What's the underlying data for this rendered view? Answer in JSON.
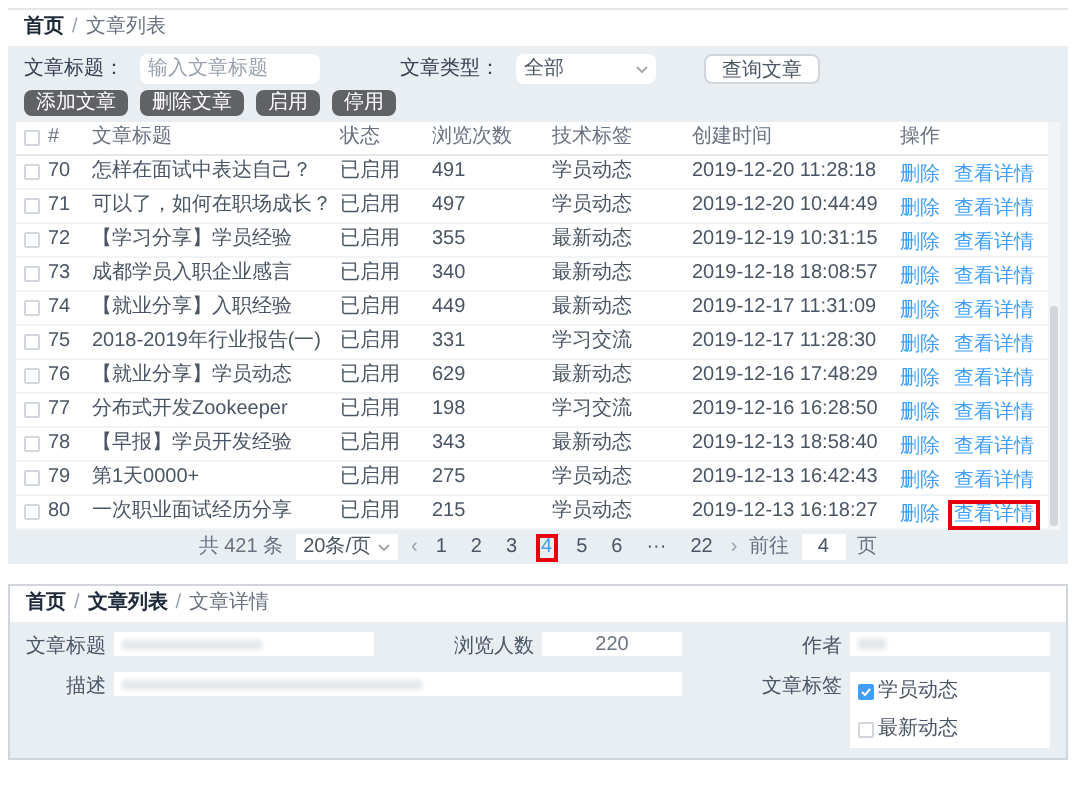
{
  "list_page": {
    "breadcrumb": [
      "首页",
      "文章列表"
    ],
    "breadcrumb_separator": "/",
    "filters": {
      "title_label": "文章标题：",
      "title_placeholder": "输入文章标题",
      "type_label": "文章类型：",
      "type_value": "全部",
      "search_button": "查询文章"
    },
    "actions": [
      "添加文章",
      "删除文章",
      "启用",
      "停用"
    ],
    "table": {
      "select_all_checked": false,
      "columns": [
        "#",
        "文章标题",
        "状态",
        "浏览次数",
        "技术标签",
        "创建时间",
        "操作"
      ],
      "rows": [
        {
          "checked": false,
          "highlighted": false,
          "cells": [
            "70",
            "怎样在面试中表达自己？",
            "已启用",
            "491",
            "学员动态",
            "2019-12-20 11:28:18"
          ],
          "links": [
            "删除",
            "查看详情"
          ]
        },
        {
          "checked": false,
          "highlighted": false,
          "cells": [
            "71",
            "可以了，如何在职场成长？",
            "已启用",
            "497",
            "学员动态",
            "2019-12-20 10:44:49"
          ],
          "links": [
            "删除",
            "查看详情"
          ]
        },
        {
          "checked": false,
          "highlighted": false,
          "cells": [
            "72",
            "【学习分享】学员经验",
            "已启用",
            "355",
            "最新动态",
            "2019-12-19 10:31:15"
          ],
          "links": [
            "删除",
            "查看详情"
          ]
        },
        {
          "checked": false,
          "highlighted": false,
          "cells": [
            "73",
            "成都学员入职企业感言",
            "已启用",
            "340",
            "最新动态",
            "2019-12-18 18:08:57"
          ],
          "links": [
            "删除",
            "查看详情"
          ]
        },
        {
          "checked": false,
          "highlighted": false,
          "cells": [
            "74",
            "【就业分享】入职经验",
            "已启用",
            "449",
            "最新动态",
            "2019-12-17 11:31:09"
          ],
          "links": [
            "删除",
            "查看详情"
          ]
        },
        {
          "checked": false,
          "highlighted": false,
          "cells": [
            "75",
            "2018-2019年行业报告(一)",
            "已启用",
            "331",
            "学习交流",
            "2019-12-17 11:28:30"
          ],
          "links": [
            "删除",
            "查看详情"
          ]
        },
        {
          "checked": false,
          "highlighted": false,
          "cells": [
            "76",
            "【就业分享】学员动态",
            "已启用",
            "629",
            "最新动态",
            "2019-12-16 17:48:29"
          ],
          "links": [
            "删除",
            "查看详情"
          ]
        },
        {
          "checked": false,
          "highlighted": false,
          "cells": [
            "77",
            "分布式开发Zookeeper",
            "已启用",
            "198",
            "学习交流",
            "2019-12-16 16:28:50"
          ],
          "links": [
            "删除",
            "查看详情"
          ]
        },
        {
          "checked": false,
          "highlighted": false,
          "cells": [
            "78",
            "【早报】学员开发经验",
            "已启用",
            "343",
            "最新动态",
            "2019-12-13 18:58:40"
          ],
          "links": [
            "删除",
            "查看详情"
          ]
        },
        {
          "checked": false,
          "highlighted": false,
          "cells": [
            "79",
            "第1天0000+",
            "已启用",
            "275",
            "学员动态",
            "2019-12-13 16:42:43"
          ],
          "links": [
            "删除",
            "查看详情"
          ]
        },
        {
          "checked": false,
          "highlighted": true,
          "cells": [
            "80",
            "一次职业面试经历分享",
            "已启用",
            "215",
            "学员动态",
            "2019-12-13 16:18:27"
          ],
          "links": [
            "删除",
            "查看详情"
          ]
        }
      ]
    },
    "pagination": {
      "total": "共 421 条",
      "page_size": "20条/页",
      "prev": "‹",
      "next": "›",
      "pages": [
        {
          "label": "1",
          "selected": false
        },
        {
          "label": "2",
          "selected": false
        },
        {
          "label": "3",
          "selected": false
        },
        {
          "label": "4",
          "selected": true
        },
        {
          "label": "5",
          "selected": false
        },
        {
          "label": "6",
          "selected": false
        },
        {
          "label": "···",
          "selected": false
        },
        {
          "label": "22",
          "selected": false
        }
      ],
      "goto_label": "前往",
      "goto_value": "4",
      "goto_unit": "页"
    }
  },
  "detail_page": {
    "breadcrumb": [
      "首页",
      "文章列表",
      "文章详情"
    ],
    "breadcrumb_separator": "/",
    "title_label": "文章标题",
    "views_label": "浏览人数",
    "views_value": "220",
    "author_label": "作者",
    "description_label": "描述",
    "tags_label": "文章标签",
    "tags": [
      {
        "label": "学员动态",
        "checked": true
      },
      {
        "label": "最新动态",
        "checked": false
      }
    ]
  }
}
